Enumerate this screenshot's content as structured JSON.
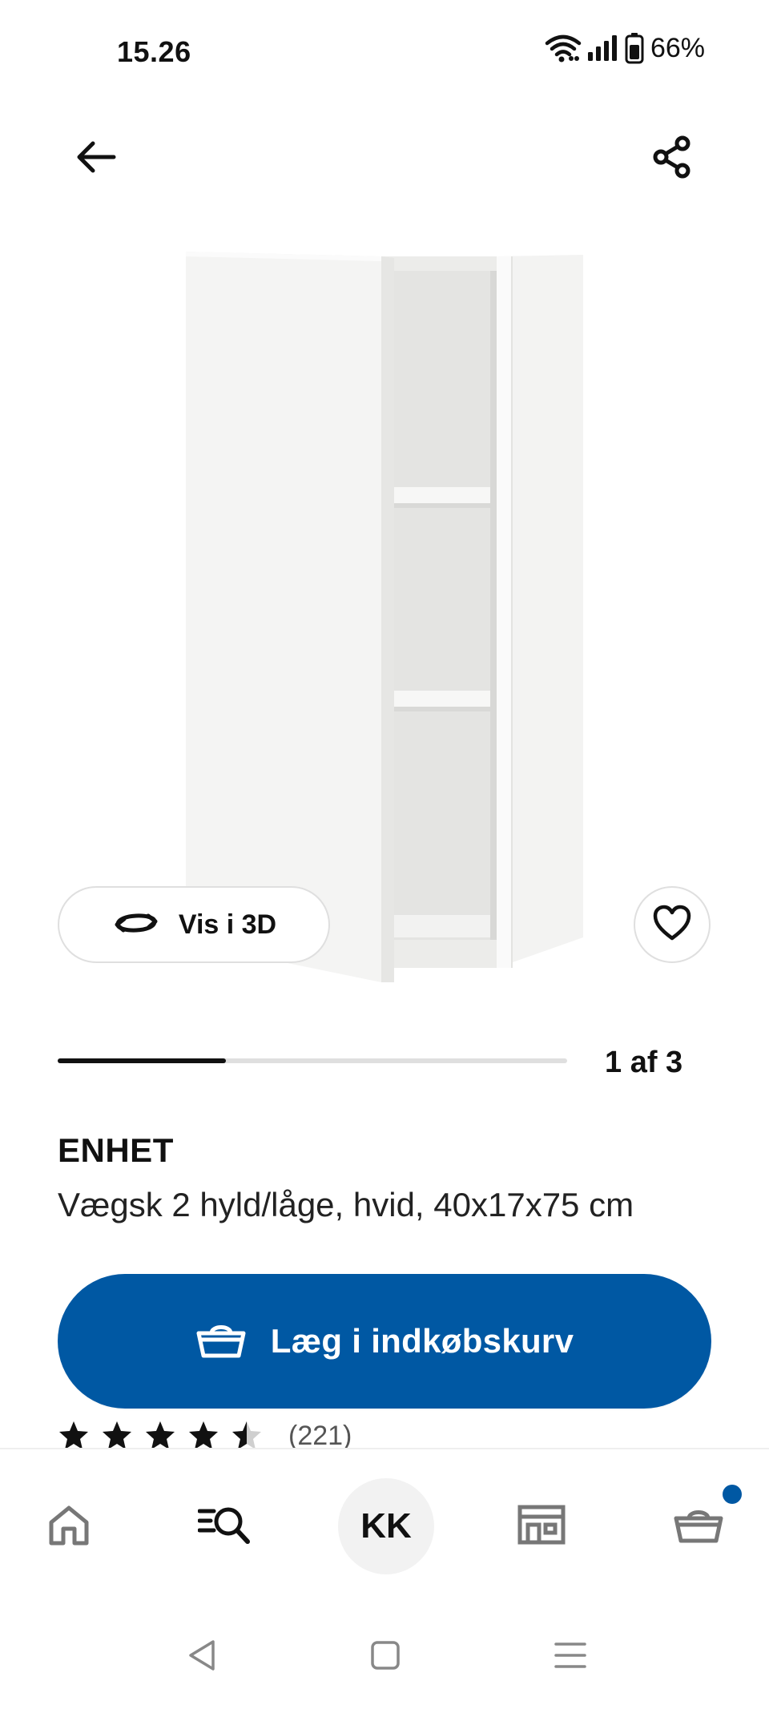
{
  "status_bar": {
    "time": "15.26",
    "battery": "66%",
    "icons": [
      "wifi-icon",
      "signal-icon",
      "battery-icon"
    ]
  },
  "top_bar": {
    "back_icon": "arrow-left-icon",
    "share_icon": "share-icon"
  },
  "gallery": {
    "vis3d_label": "Vis i 3D",
    "vis3d_icon": "rotate-3d-icon",
    "favorite_icon": "heart-icon",
    "counter": "1 af 3",
    "progress_fraction": 0.33
  },
  "product": {
    "name": "ENHET",
    "description": "Vægsk 2 hyld/låge, hvid, 40x17x75 cm",
    "rating_value": 4.5,
    "rating_count": "(221)"
  },
  "cart_button": {
    "label": "Læg i indkøbskurv",
    "icon": "basket-icon",
    "color": "#0058a3"
  },
  "bottom_nav": {
    "items": [
      "home-icon",
      "search-list-icon",
      "profile-avatar",
      "store-icon",
      "basket-icon"
    ],
    "avatar_initials": "KK",
    "cart_badge_color": "#0058a3"
  },
  "system_nav": {
    "items": [
      "back-triangle-icon",
      "home-square-icon",
      "recents-menu-icon"
    ]
  }
}
